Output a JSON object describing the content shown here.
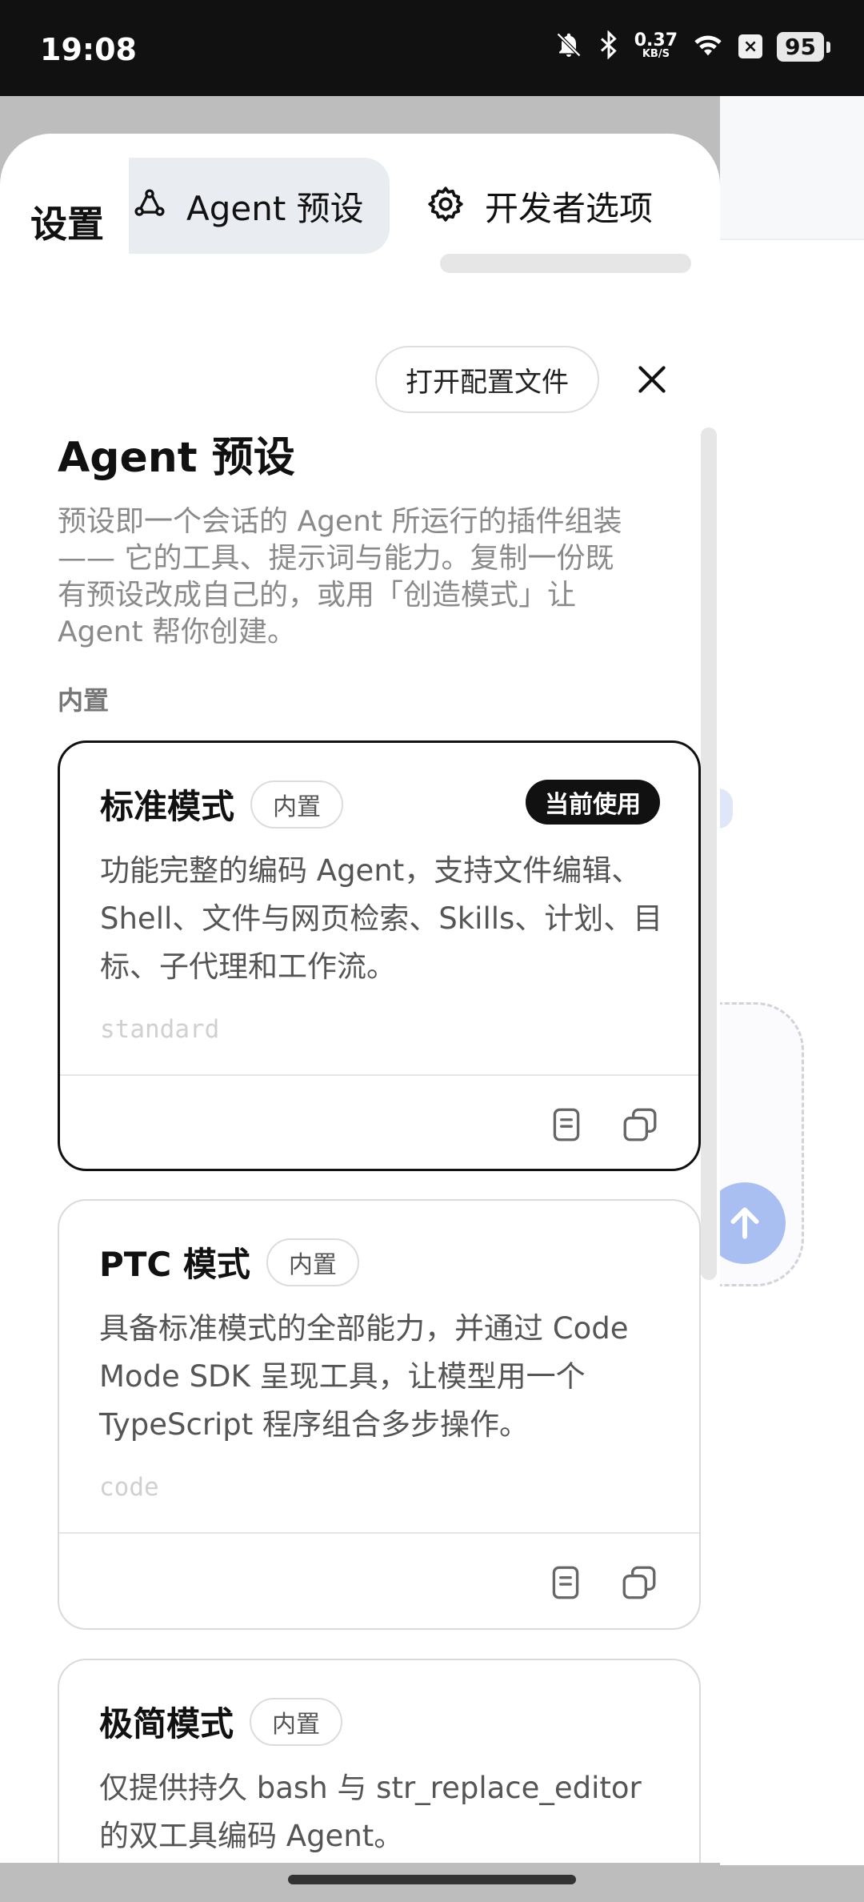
{
  "status_bar": {
    "time": "19:08",
    "speed_value": "0.37",
    "speed_unit": "KB/S",
    "battery": "95",
    "x_badge": "×"
  },
  "sheet": {
    "title": "设置",
    "tabs": [
      {
        "label": "Agent 预设",
        "icon": "agent-icon",
        "selected": true
      },
      {
        "label": "开发者选项",
        "icon": "gear-icon",
        "selected": false
      }
    ],
    "open_config_label": "打开配置文件",
    "heading": "Agent 预设",
    "description": "预设即一个会话的 Agent 所运行的插件组装 —— 它的工具、提示词与能力。复制一份既有预设改成自己的，或用「创造模式」让 Agent 帮你创建。",
    "section_builtin": "内置",
    "cards": [
      {
        "name": "标准模式",
        "builtin_label": "内置",
        "current_label": "当前使用",
        "description": "功能完整的编码 Agent，支持文件编辑、Shell、文件与网页检索、Skills、计划、目标、子代理和工作流。",
        "slug": "standard"
      },
      {
        "name": "PTC 模式",
        "builtin_label": "内置",
        "description": "具备标准模式的全部能力，并通过 Code Mode SDK 呈现工具，让模型用一个 TypeScript 程序组合多步操作。",
        "slug": "code"
      },
      {
        "name": "极简模式",
        "builtin_label": "内置",
        "description": "仅提供持久 bash 与 str_replace_editor 的双工具编码 Agent。"
      }
    ]
  },
  "colors": {
    "active_border": "#111111",
    "badge_bg": "#111111",
    "send_button": "#a9bff2"
  }
}
